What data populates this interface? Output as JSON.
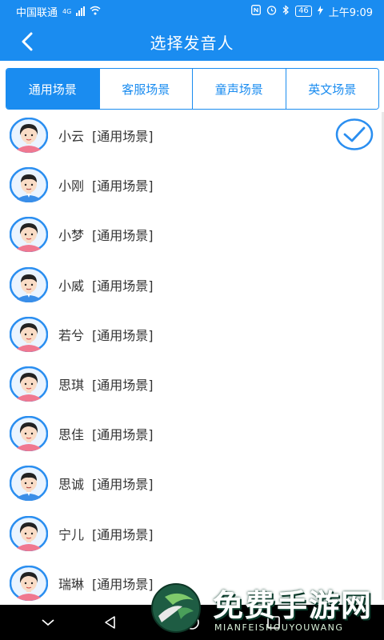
{
  "status_bar": {
    "carrier": "中国联通",
    "network": "4G",
    "battery": "46",
    "time": "上午9:09"
  },
  "header": {
    "title": "选择发音人",
    "back_icon": "chevron-left-icon"
  },
  "tabs": [
    {
      "label": "通用场景",
      "active": true
    },
    {
      "label": "客服场景",
      "active": false
    },
    {
      "label": "童声场景",
      "active": false
    },
    {
      "label": "英文场景",
      "active": false
    }
  ],
  "voices": [
    {
      "name": "小云",
      "scene": "[通用场景]",
      "gender": "female",
      "selected": true
    },
    {
      "name": "小刚",
      "scene": "[通用场景]",
      "gender": "male",
      "selected": false
    },
    {
      "name": "小梦",
      "scene": "[通用场景]",
      "gender": "female",
      "selected": false
    },
    {
      "name": "小威",
      "scene": "[通用场景]",
      "gender": "male",
      "selected": false
    },
    {
      "name": "若兮",
      "scene": "[通用场景]",
      "gender": "female",
      "selected": false
    },
    {
      "name": "思琪",
      "scene": "[通用场景]",
      "gender": "female",
      "selected": false
    },
    {
      "name": "思佳",
      "scene": "[通用场景]",
      "gender": "female",
      "selected": false
    },
    {
      "name": "思诚",
      "scene": "[通用场景]",
      "gender": "male",
      "selected": false
    },
    {
      "name": "宁儿",
      "scene": "[通用场景]",
      "gender": "female",
      "selected": false
    },
    {
      "name": "瑞琳",
      "scene": "[通用场景]",
      "gender": "female",
      "selected": false
    }
  ],
  "watermark": {
    "title": "免费手游网",
    "subtitle": "MIANFEISHOUYOUWANG"
  },
  "colors": {
    "primary": "#1a8cf0",
    "text": "#333333"
  }
}
